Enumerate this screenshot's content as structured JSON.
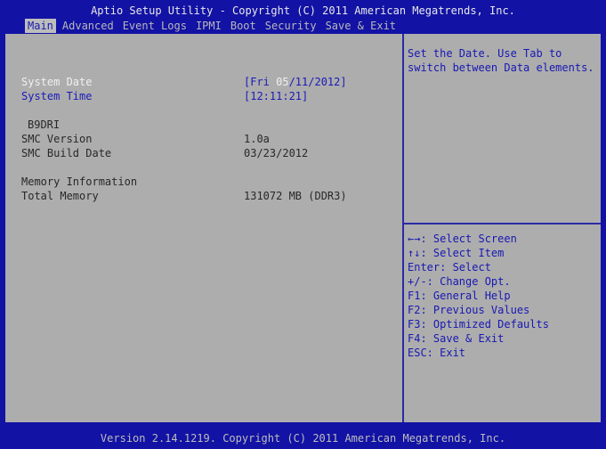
{
  "header": {
    "title": "Aptio Setup Utility - Copyright (C) 2011 American Megatrends, Inc.",
    "tabs": [
      "Main",
      "Advanced",
      "Event Logs",
      "IPMI",
      "Boot",
      "Security",
      "Save & Exit"
    ],
    "active_tab": "Main"
  },
  "main": {
    "system_date_label": "System Date",
    "system_date_value_prefix": "[Fri ",
    "system_date_value_selected": "05",
    "system_date_value_suffix": "/11/2012]",
    "system_time_label": "System Time",
    "system_time_value": "[12:11:21]",
    "board_name": "B9DRI",
    "smc_version_label": "SMC Version",
    "smc_version_value": "1.0a",
    "smc_build_date_label": "SMC Build Date",
    "smc_build_date_value": "03/23/2012",
    "memory_section_label": "Memory Information",
    "total_memory_label": "Total Memory",
    "total_memory_value": "131072 MB (DDR3)"
  },
  "help": {
    "text_line1": "Set the Date. Use Tab to",
    "text_line2": "switch between Data elements.",
    "keys": [
      "←→: Select Screen",
      "↑↓: Select Item",
      "Enter: Select",
      "+/-: Change Opt.",
      "F1: General Help",
      "F2: Previous Values",
      "F3: Optimized Defaults",
      "F4: Save & Exit",
      "ESC: Exit"
    ]
  },
  "footer": {
    "text": "Version 2.14.1219. Copyright (C) 2011 American Megatrends, Inc."
  },
  "colors": {
    "background": "#1212a4",
    "panel": "#adadad",
    "accent_blue": "#1a1ab8",
    "active_tab_bg": "#bdbdbd"
  }
}
